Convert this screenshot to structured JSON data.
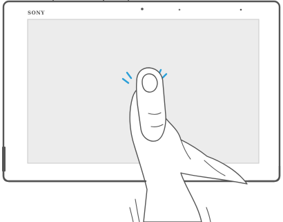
{
  "device": {
    "brand": "SONY"
  },
  "illustration": {
    "gesture": "tap",
    "colors": {
      "outline": "#555555",
      "screen": "#ececec",
      "frame": "#ffffff",
      "tap_accent": "#2a9fd8",
      "hand_fill": "#ffffff"
    }
  }
}
